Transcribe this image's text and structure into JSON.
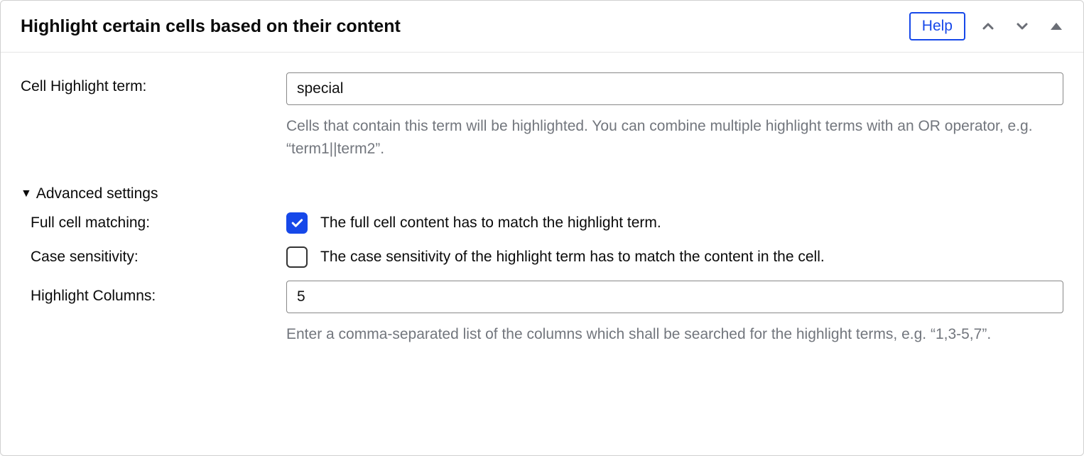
{
  "header": {
    "title": "Highlight certain cells based on their content",
    "help_label": "Help"
  },
  "form": {
    "highlight_term": {
      "label": "Cell Highlight term:",
      "value": "special",
      "help": "Cells that contain this term will be highlighted. You can combine multiple highlight terms with an OR operator, e.g. “term1||term2”."
    },
    "advanced": {
      "label": "Advanced settings",
      "full_match": {
        "label": "Full cell matching:",
        "desc": "The full cell content has to match the highlight term.",
        "checked": true
      },
      "case_sens": {
        "label": "Case sensitivity:",
        "desc": "The case sensitivity of the highlight term has to match the content in the cell.",
        "checked": false
      },
      "columns": {
        "label": "Highlight Columns:",
        "value": "5",
        "help": "Enter a comma-separated list of the columns which shall be searched for the highlight terms, e.g. “1,3-5,7”."
      }
    }
  }
}
